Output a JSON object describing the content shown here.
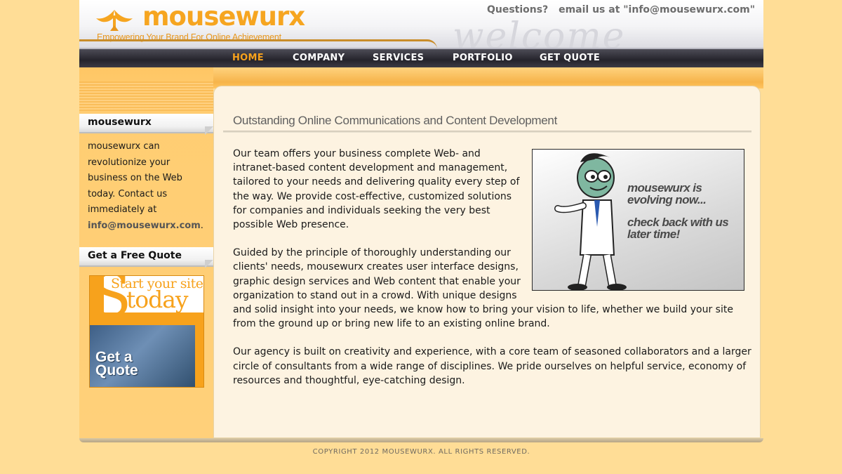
{
  "header": {
    "logo_text": "mousewurx",
    "tagline": "Empowering Your Brand For Online Achievement",
    "contact_question": "Questions?",
    "contact_email_text": "email us at \"info@mousewurx.com\"",
    "watermark": "welcome"
  },
  "nav": {
    "items": [
      {
        "label": "HOME",
        "active": true
      },
      {
        "label": "COMPANY",
        "active": false
      },
      {
        "label": "SERVICES",
        "active": false
      },
      {
        "label": "PORTFOLIO",
        "active": false
      },
      {
        "label": "GET QUOTE",
        "active": false
      }
    ]
  },
  "sidebar": {
    "about_heading": "mousewurx",
    "about_text": "mousewurx can revolutionize your business on the Web today. Contact us immediately at ",
    "about_email": "info@mousewurx.com",
    "about_end": ".",
    "quote_heading": "Get a Free Quote",
    "banner": {
      "start": "Start your site",
      "today": "today",
      "cta": [
        "Get a",
        "Quote"
      ]
    }
  },
  "main": {
    "title": "Outstanding Online Communications and Content Development",
    "paragraphs": [
      "Our team offers your business complete Web- and intranet-based content development and management, tailored to your needs and delivering quality every step of the way. We provide cost-effective, customized solutions for companies and individuals seeking the very best possible Web presence.",
      "Guided by the principle of thoroughly understanding our clients' needs, mousewurx creates user interface designs, graphic design services and Web content that enable your organization to stand out in a crowd. With unique designs and solid insight into your needs, we know how to bring your vision to life, whether we build your site from the ground up or bring new life to an existing online brand.",
      "Our agency is built on creativity and experience, with a core team of seasoned collaborators and a larger circle of consultants from a wide range of disciplines. We pride ourselves on helpful service, economy of resources and thoughtful, eye-catching design."
    ],
    "hero_lines": [
      "mousewurx is evolving now...",
      "check back with us later time!"
    ]
  },
  "footer": {
    "copyright": "COPYRIGHT 2012 MOUSEWURX. ALL RIGHTS RESERVED."
  },
  "colors": {
    "page_bg": "#ffdd96",
    "accent_orange": "#f7a21c",
    "nav_bg": "#25242c",
    "content_bg": "#fdf3e1"
  }
}
